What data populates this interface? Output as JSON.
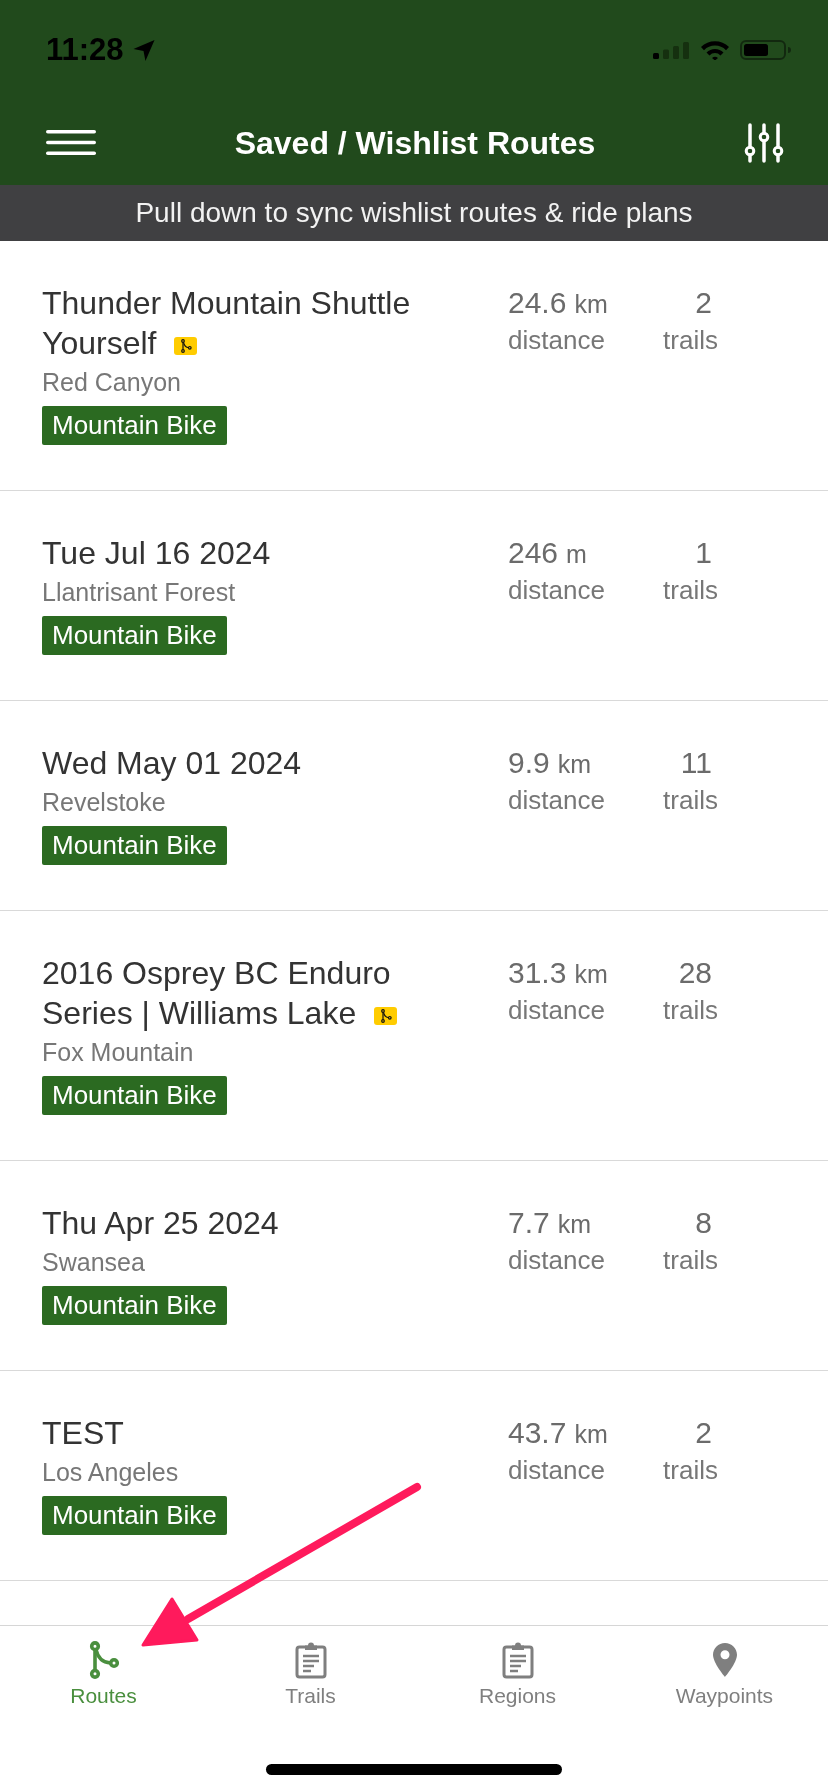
{
  "status_bar": {
    "time": "11:28"
  },
  "header": {
    "title": "Saved / Wishlist Routes"
  },
  "sync_banner": {
    "text": "Pull down to sync wishlist routes & ride plans"
  },
  "routes": [
    {
      "title": "Thunder Mountain Shuttle Yourself",
      "route_badge": true,
      "region": "Red Canyon",
      "tag": "Mountain Bike",
      "distance": "24.6",
      "unit": "km",
      "distance_label": "distance",
      "trails": "2",
      "trails_label": "trails"
    },
    {
      "title": "Tue Jul 16 2024",
      "route_badge": false,
      "region": "Llantrisant Forest",
      "tag": "Mountain Bike",
      "distance": "246",
      "unit": "m",
      "distance_label": "distance",
      "trails": "1",
      "trails_label": "trails"
    },
    {
      "title": "Wed May 01 2024",
      "route_badge": false,
      "region": "Revelstoke",
      "tag": "Mountain Bike",
      "distance": "9.9",
      "unit": "km",
      "distance_label": "distance",
      "trails": "11",
      "trails_label": "trails"
    },
    {
      "title": "2016 Osprey BC Enduro Series | Williams Lake",
      "route_badge": true,
      "region": "Fox Mountain",
      "tag": "Mountain Bike",
      "distance": "31.3",
      "unit": "km",
      "distance_label": "distance",
      "trails": "28",
      "trails_label": "trails"
    },
    {
      "title": "Thu Apr 25 2024",
      "route_badge": false,
      "region": "Swansea",
      "tag": "Mountain Bike",
      "distance": "7.7",
      "unit": "km",
      "distance_label": "distance",
      "trails": "8",
      "trails_label": "trails"
    },
    {
      "title": "TEST",
      "route_badge": false,
      "region": "Los Angeles",
      "tag": "Mountain Bike",
      "distance": "43.7",
      "unit": "km",
      "distance_label": "distance",
      "trails": "2",
      "trails_label": "trails"
    }
  ],
  "tab_bar": {
    "tabs": [
      {
        "kind": "routes",
        "label": "Routes",
        "selected": true
      },
      {
        "kind": "trails",
        "label": "Trails",
        "selected": false
      },
      {
        "kind": "regions",
        "label": "Regions",
        "selected": false
      },
      {
        "kind": "waypoints",
        "label": "Waypoints",
        "selected": false
      }
    ]
  }
}
